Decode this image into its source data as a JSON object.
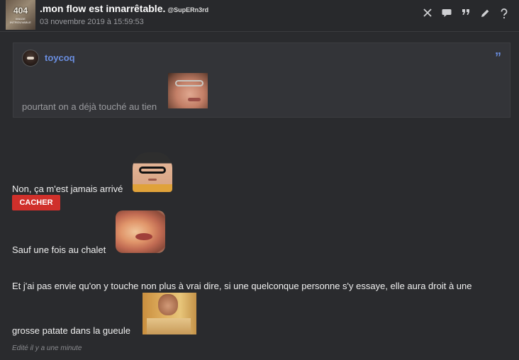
{
  "header": {
    "avatar_big": "404",
    "avatar_small": "IMAGE INTROUVABLE",
    "title": ".mon flow est innarrêtable.",
    "handle": "@SupERn3rd",
    "date": "03 novembre 2019 à 15:59:53",
    "icons": [
      "close-icon",
      "comment-icon",
      "quote-icon",
      "edit-icon",
      "help-icon"
    ]
  },
  "quote": {
    "username": "toycoq",
    "text": "pourtant on a déjà touché au tien"
  },
  "post": {
    "line1": "Non, ça m'est jamais arrivé",
    "spoiler_button": "CACHER",
    "line2": "Sauf une fois au chalet",
    "line3": "Et j'ai pas envie qu'on y touche non plus à vrai dire, si une quelconque personne s'y essaye, elle aura droit à une",
    "line4": "grosse patate dans la gueule",
    "edited": "Edité il y a une minute"
  },
  "colors": {
    "background": "#2a2b2e",
    "username": "#6a8ee0",
    "spoiler_button": "#d0302b"
  }
}
